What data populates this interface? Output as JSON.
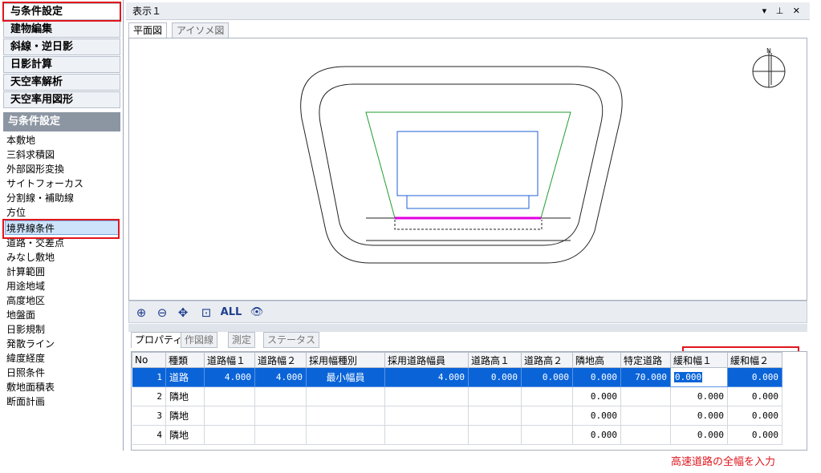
{
  "nav": {
    "buttons": [
      "与条件設定",
      "建物編集",
      "斜線・逆日影",
      "日影計算",
      "天空率解析",
      "天空率用図形"
    ],
    "section_header": "与条件設定",
    "items": [
      "本敷地",
      "三斜求積図",
      "外部図形変換",
      "サイトフォーカス",
      "分割線・補助線",
      "方位",
      "境界線条件",
      "道路・交差点",
      "みなし敷地",
      "計算範囲",
      "用途地域",
      "高度地区",
      "地盤面",
      "日影規制",
      "発散ライン",
      "緯度経度",
      "日照条件",
      "敷地面積表",
      "断面計画"
    ]
  },
  "window": {
    "title": "表示１",
    "controls": "▾ ⊥ ✕",
    "view_tabs": [
      "平面図",
      "アイソメ図"
    ]
  },
  "toolbar": {
    "zoom_in": "⊕",
    "zoom_out": "⊖",
    "pan": "✥",
    "zoom_window": "⊡",
    "all_label": "ALL",
    "view": "👁"
  },
  "property_tabs": [
    "プロパティ",
    "作図線",
    "測定",
    "ステータス"
  ],
  "grid": {
    "headers": [
      "No",
      "種類",
      "道路幅１",
      "道路幅２",
      "採用幅種別",
      "採用道路幅員",
      "道路高１",
      "道路高２",
      "隣地高",
      "特定道路",
      "緩和幅１",
      "緩和幅２"
    ],
    "rows": [
      {
        "no": "1",
        "type": "道路",
        "w1": "4.000",
        "w2": "4.000",
        "kind": "最小幅員",
        "width": "4.000",
        "h1": "0.000",
        "h2": "0.000",
        "adj": "0.000",
        "special": "70.000",
        "r1": "0.000",
        "r2": "0.000"
      },
      {
        "no": "2",
        "type": "隣地",
        "w1": "",
        "w2": "",
        "kind": "",
        "width": "",
        "h1": "",
        "h2": "",
        "adj": "0.000",
        "special": "",
        "r1": "0.000",
        "r2": "0.000"
      },
      {
        "no": "3",
        "type": "隣地",
        "w1": "",
        "w2": "",
        "kind": "",
        "width": "",
        "h1": "",
        "h2": "",
        "adj": "0.000",
        "special": "",
        "r1": "0.000",
        "r2": "0.000"
      },
      {
        "no": "4",
        "type": "隣地",
        "w1": "",
        "w2": "",
        "kind": "",
        "width": "",
        "h1": "",
        "h2": "",
        "adj": "0.000",
        "special": "",
        "r1": "0.000",
        "r2": "0.000"
      }
    ]
  },
  "annotation": "高速道路の全幅を入力",
  "colors": {
    "accent": "#e0161e",
    "selection": "#0a64d8",
    "site": "#2ca02c",
    "building": "#1f5fd6",
    "boundary": "#e000e0"
  }
}
